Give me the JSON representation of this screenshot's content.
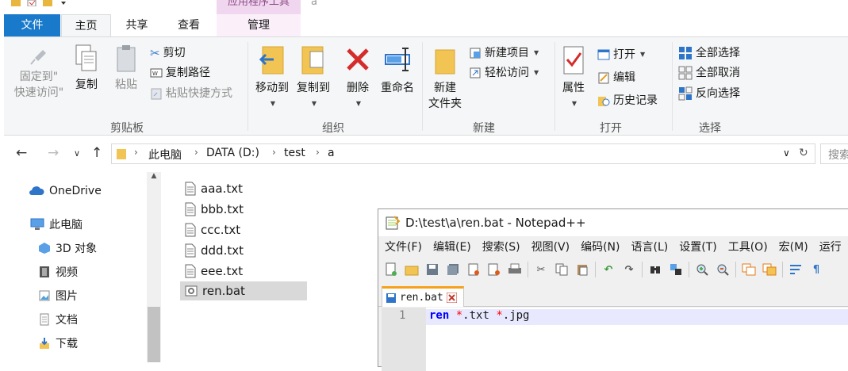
{
  "title_bar": {
    "context_tab_title": "应用程序工具",
    "window_title": "a"
  },
  "ribbon_tabs": [
    {
      "label": "文件"
    },
    {
      "label": "主页"
    },
    {
      "label": "共享"
    },
    {
      "label": "查看"
    },
    {
      "label": "管理"
    }
  ],
  "ribbon": {
    "clipboard": {
      "pin_label_1": "固定到\"",
      "pin_label_2": "快速访问\"",
      "copy_label": "复制",
      "paste_label": "粘贴",
      "cut_label": "剪切",
      "copy_path_label": "复制路径",
      "paste_shortcut_label": "粘贴快捷方式",
      "group_label": "剪贴板"
    },
    "organize": {
      "move_to_label": "移动到",
      "copy_to_label": "复制到",
      "delete_label": "删除",
      "rename_label": "重命名",
      "group_label": "组织"
    },
    "new": {
      "new_folder_label_1": "新建",
      "new_folder_label_2": "文件夹",
      "new_item_label": "新建项目",
      "easy_access_label": "轻松访问",
      "group_label": "新建"
    },
    "open": {
      "properties_label": "属性",
      "open_label": "打开",
      "edit_label": "编辑",
      "history_label": "历史记录",
      "group_label": "打开"
    },
    "select": {
      "select_all_label": "全部选择",
      "select_none_label": "全部取消",
      "invert_label": "反向选择",
      "group_label": "选择"
    }
  },
  "address_bar": {
    "breadcrumbs": [
      "此电脑",
      "DATA (D:)",
      "test",
      "a"
    ],
    "search_placeholder": "搜索"
  },
  "nav_pane": {
    "items": [
      {
        "label": "OneDrive",
        "icon": "cloud-icon"
      },
      {
        "label": "此电脑",
        "icon": "computer-icon"
      },
      {
        "label": "3D 对象",
        "icon": "cube-icon"
      },
      {
        "label": "视频",
        "icon": "video-icon"
      },
      {
        "label": "图片",
        "icon": "picture-icon"
      },
      {
        "label": "文档",
        "icon": "document-icon"
      },
      {
        "label": "下载",
        "icon": "download-icon"
      }
    ]
  },
  "files": [
    {
      "name": "aaa.txt",
      "selected": false
    },
    {
      "name": "bbb.txt",
      "selected": false
    },
    {
      "name": "ccc.txt",
      "selected": false
    },
    {
      "name": "ddd.txt",
      "selected": false
    },
    {
      "name": "eee.txt",
      "selected": false
    },
    {
      "name": "ren.bat",
      "selected": true
    }
  ],
  "notepad": {
    "title": "D:\\test\\a\\ren.bat - Notepad++",
    "menu": [
      "文件(F)",
      "编辑(E)",
      "搜索(S)",
      "视图(V)",
      "编码(N)",
      "语言(L)",
      "设置(T)",
      "工具(O)",
      "宏(M)",
      "运行"
    ],
    "tab_label": "ren.bat",
    "line_number": "1",
    "code": {
      "keyword": "ren",
      "op1": "*",
      "arg1": ".txt",
      "op2": "*",
      "arg2": ".jpg"
    }
  },
  "colors": {
    "file_tab_bg": "#1979ca",
    "context_tab_bg": "#f1d6ef",
    "selection_bg": "#d9d9d9",
    "npp_current_line": "#e8e8ff",
    "npp_keyword": "#0000ff",
    "npp_operator": "#ff0000"
  }
}
